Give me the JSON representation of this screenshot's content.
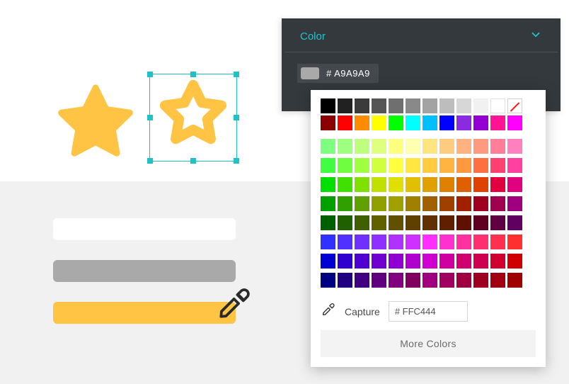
{
  "panel": {
    "title": "Color",
    "swatch_color": "#a9a9a9",
    "swatch_hex_display": "# A9A9A9"
  },
  "picker": {
    "capture_label": "Capture",
    "hex_value": "# FFC444",
    "more_colors_label": "More Colors",
    "row_grays": [
      "#000000",
      "#212121",
      "#3b3b3b",
      "#555555",
      "#6f6f6f",
      "#898989",
      "#a3a3a3",
      "#bdbdbd",
      "#d7d7d7",
      "#f1f1f1",
      "#ffffff",
      "none"
    ],
    "row_primaries": [
      "#8b0000",
      "#ff0000",
      "#ff8c00",
      "#ffff00",
      "#00ff00",
      "#00ffff",
      "#00bfff",
      "#0000ff",
      "#8a2be2",
      "#9400d3",
      "#ff1493",
      "#ff00ff"
    ],
    "grid": [
      [
        "#7fff7f",
        "#9fff7f",
        "#bfff7f",
        "#dfff7f",
        "#ffff7f",
        "#ffffb0",
        "#ffe57f",
        "#ffcc7f",
        "#ffb27f",
        "#ff997f",
        "#ff7f99",
        "#ff7fbf"
      ],
      [
        "#40ff40",
        "#70ff40",
        "#a0ff40",
        "#d0ff40",
        "#ffff40",
        "#ffe640",
        "#ffcc40",
        "#ffb340",
        "#ff9940",
        "#ff7040",
        "#ff4070",
        "#ff40a0"
      ],
      [
        "#00e000",
        "#40e000",
        "#80e000",
        "#c0e000",
        "#e0e000",
        "#e0c000",
        "#e0a000",
        "#e08000",
        "#e06000",
        "#e04000",
        "#e00040",
        "#e00080"
      ],
      [
        "#00a000",
        "#30a000",
        "#60a000",
        "#90a000",
        "#a0a000",
        "#a08000",
        "#a06000",
        "#a04000",
        "#a02000",
        "#a00020",
        "#a00050",
        "#a00080"
      ],
      [
        "#006000",
        "#206000",
        "#406000",
        "#606000",
        "#605000",
        "#604000",
        "#603000",
        "#602000",
        "#601000",
        "#600020",
        "#600040",
        "#600060"
      ],
      [
        "#3030ff",
        "#5030ff",
        "#7030ff",
        "#9030ff",
        "#b030ff",
        "#d030ff",
        "#ff30ff",
        "#ff30d0",
        "#ff30a0",
        "#ff3070",
        "#ff3050",
        "#ff3030"
      ],
      [
        "#0000d0",
        "#3000d0",
        "#5000d0",
        "#7000d0",
        "#9000d0",
        "#b000d0",
        "#d000d0",
        "#d000a0",
        "#d00070",
        "#d00050",
        "#d00030",
        "#d00000"
      ],
      [
        "#000080",
        "#200080",
        "#400080",
        "#600080",
        "#800080",
        "#800060",
        "#a00080",
        "#a00060",
        "#a00040",
        "#a00020",
        "#a00010",
        "#a00000"
      ]
    ]
  },
  "bars": {
    "colors": [
      "#ffffff",
      "#a9a9a9",
      "#ffc444"
    ]
  },
  "stars": {
    "color": "#ffc444"
  }
}
